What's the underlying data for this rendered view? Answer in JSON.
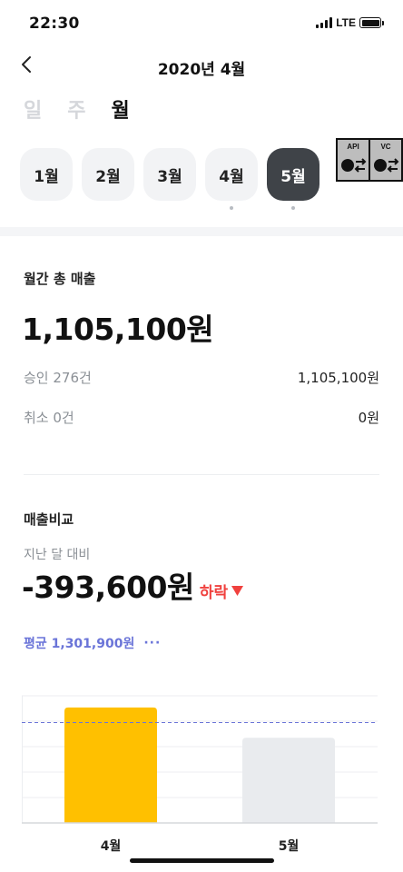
{
  "status": {
    "time": "22:30",
    "network": "LTE"
  },
  "header": {
    "title": "2020년 4월"
  },
  "period_tabs": [
    {
      "label": "일",
      "active": false
    },
    {
      "label": "주",
      "active": false
    },
    {
      "label": "월",
      "active": true
    }
  ],
  "months": [
    {
      "label": "1월",
      "active": false,
      "dot": false
    },
    {
      "label": "2월",
      "active": false,
      "dot": false
    },
    {
      "label": "3월",
      "active": false,
      "dot": false
    },
    {
      "label": "4월",
      "active": false,
      "dot": true
    },
    {
      "label": "5월",
      "active": true,
      "dot": true
    }
  ],
  "overlay": {
    "api_label": "API",
    "vc_label": "VC"
  },
  "monthly": {
    "title": "월간 총 매출",
    "total": "1,105,100원",
    "approved_label": "승인 276건",
    "approved_value": "1,105,100원",
    "canceled_label": "취소 0건",
    "canceled_value": "0원"
  },
  "comparison": {
    "title": "매출비교",
    "subtitle": "지난 달 대비",
    "difference": "-393,600원",
    "trend": "하락",
    "average": "평균 1,301,900원",
    "more": "···"
  },
  "colors": {
    "accent_bar": "#FFC000",
    "muted_bar": "#E9EBEE",
    "down": "#F0413E",
    "avg": "#6A74D8"
  },
  "chart_data": {
    "type": "bar",
    "categories": [
      "4월",
      "5월"
    ],
    "values": [
      1498700,
      1105100
    ],
    "average": 1301900,
    "ylim": [
      0,
      1650000
    ],
    "grid": true
  }
}
